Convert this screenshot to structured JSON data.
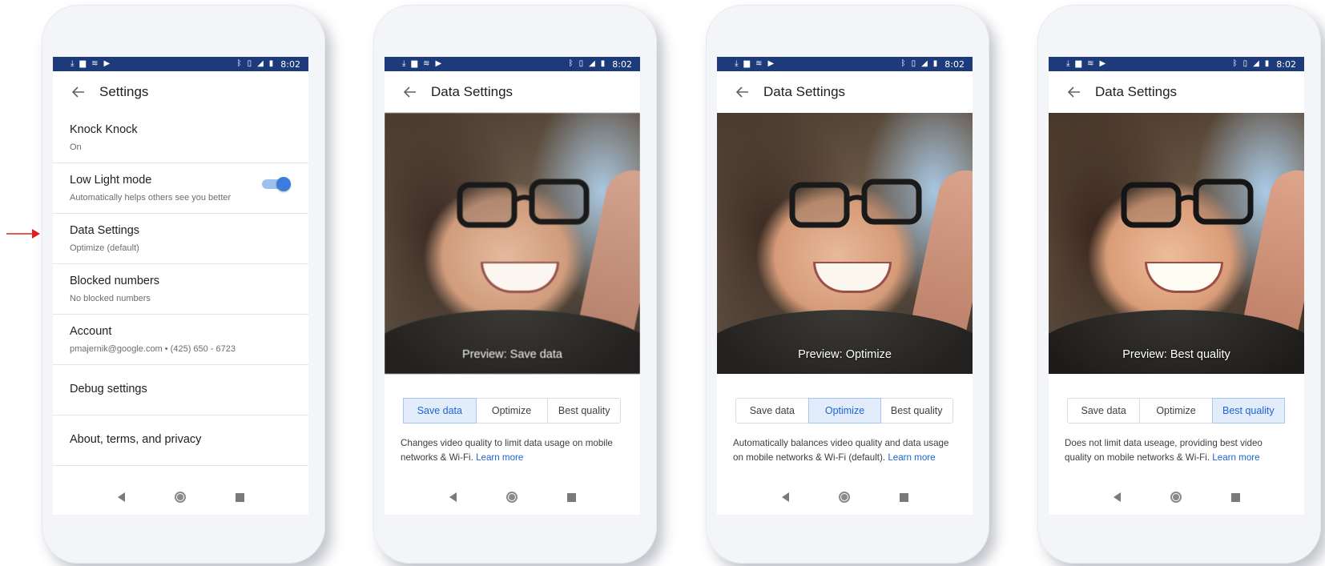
{
  "status_bar": {
    "time": "8:02"
  },
  "phone1": {
    "title": "Settings",
    "items": [
      {
        "title": "Knock Knock",
        "subtitle": "On"
      },
      {
        "title": "Low Light mode",
        "subtitle": "Automatically helps others see you better",
        "toggle": true
      },
      {
        "title": "Data Settings",
        "subtitle": "Optimize (default)"
      },
      {
        "title": "Blocked numbers",
        "subtitle": "No blocked numbers"
      },
      {
        "title": "Account",
        "subtitle": "pmajernik@google.com  •  (425) 650 - 6723"
      },
      {
        "title": "Debug settings"
      },
      {
        "title": "About, terms, and privacy"
      }
    ]
  },
  "segment_options": [
    "Save data",
    "Optimize",
    "Best quality"
  ],
  "phone2": {
    "title": "Data Settings",
    "preview_label": "Preview: Save data",
    "desc_text": "Changes video quality to limit data usage on mobile networks & Wi-Fi.",
    "learn_more": "Learn more"
  },
  "phone3": {
    "title": "Data Settings",
    "preview_label": "Preview: Optimize",
    "desc_text": "Automatically balances video quality and data usage on mobile networks & Wi-Fi (default).",
    "learn_more": "Learn more"
  },
  "phone4": {
    "title": "Data Settings",
    "preview_label": "Preview: Best quality",
    "desc_text": "Does not limit data useage, providing best video quality on mobile networks & Wi-Fi.",
    "learn_more": "Learn more"
  },
  "colors": {
    "status_bar": "#1d3a7b",
    "accent": "#1a66d2",
    "toggle": "#3b7ddd",
    "pointer_arrow": "#e02020"
  },
  "icons": [
    "download-icon",
    "image-icon",
    "wifi-icon",
    "play-icon",
    "bluetooth-icon",
    "vibrate-icon",
    "signal-icon",
    "battery-icon",
    "back-arrow-icon",
    "nav-back-icon",
    "nav-home-icon",
    "nav-recent-icon"
  ]
}
